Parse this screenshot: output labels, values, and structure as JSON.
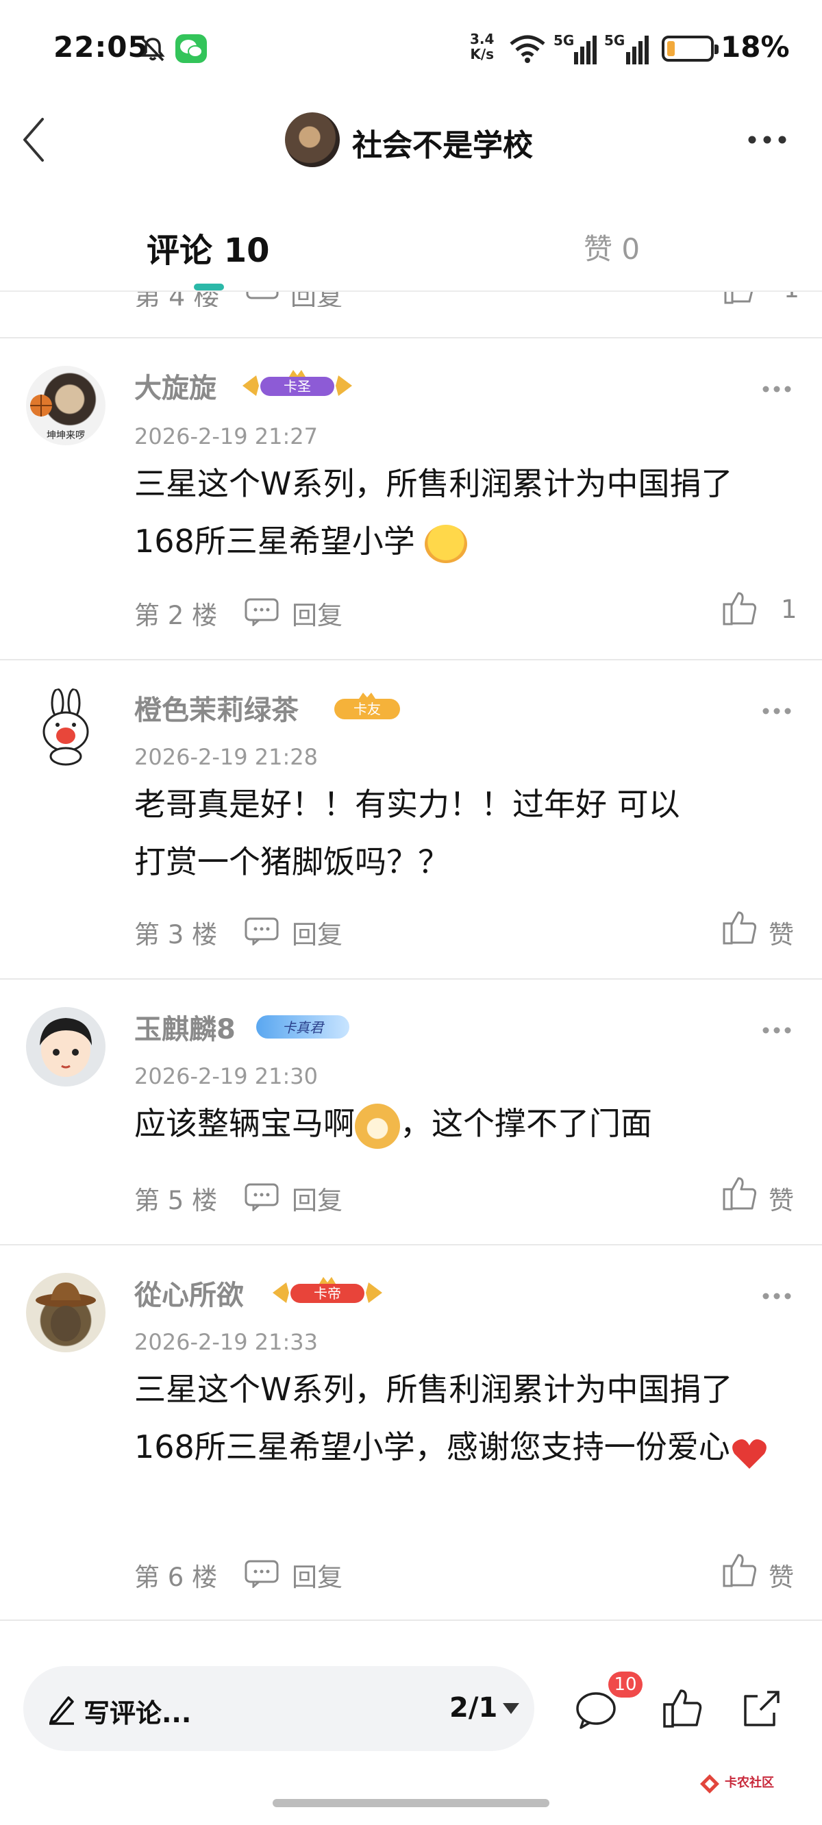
{
  "status_bar": {
    "time": "22:05",
    "net_speed_value": "3.4",
    "net_speed_unit": "K/s",
    "signal1_label": "5G",
    "signal2_label": "5G",
    "battery_percent": "18%",
    "battery_level": 0.18,
    "battery_color": "#f2a93b"
  },
  "header": {
    "title": "社会不是学校"
  },
  "tabs": {
    "comments": "评论 10",
    "likes": "赞 0",
    "accent": "#2bb8a8"
  },
  "partial_row": {
    "floor": "第 4 楼",
    "reply": "回复",
    "like_count": "1"
  },
  "comments": [
    {
      "user": "大旋旋",
      "badge": "卡圣",
      "avatar_caption": "坤坤来啰",
      "date": "2026-2-19 21:27",
      "text": "三星这个W系列，所售利润累计为中国捐了168所三星希望小学",
      "floor": "第 2 楼",
      "reply": "回复",
      "likes": "1"
    },
    {
      "user": "橙色茉莉绿茶",
      "badge": "卡友",
      "date": "2026-2-19 21:28",
      "text_line1": "老哥真是好！！有实力！！过年好  可以",
      "text_line2": "打赏一个猪脚饭吗？？",
      "floor": "第 3 楼",
      "reply": "回复",
      "likes": "赞"
    },
    {
      "user": "玉麒麟8",
      "badge": "卡真君",
      "date": "2026-2-19 21:30",
      "text_before": "应该整辆宝马啊",
      "text_after": "，这个撑不了门面",
      "floor": "第 5 楼",
      "reply": "回复",
      "likes": "赞"
    },
    {
      "user": "從心所欲",
      "badge": "卡帝",
      "date": "2026-2-19 21:33",
      "text": "三星这个W系列，所售利润累计为中国捐了168所三星希望小学，感谢您支持一份爱心",
      "floor": "第 6 楼",
      "reply": "回复",
      "likes": "赞"
    }
  ],
  "bottom_bar": {
    "write_placeholder": "写评论...",
    "page_indicator": "2/1",
    "comment_count": "10",
    "watermark": "卡农社区"
  },
  "icons": [
    "mute-icon",
    "wechat-icon",
    "wifi-icon",
    "signal-icon",
    "battery-icon",
    "back-icon",
    "more-icon",
    "reply-icon",
    "like-icon",
    "pencil-icon",
    "caret-down-icon",
    "comment-icon",
    "share-icon"
  ]
}
